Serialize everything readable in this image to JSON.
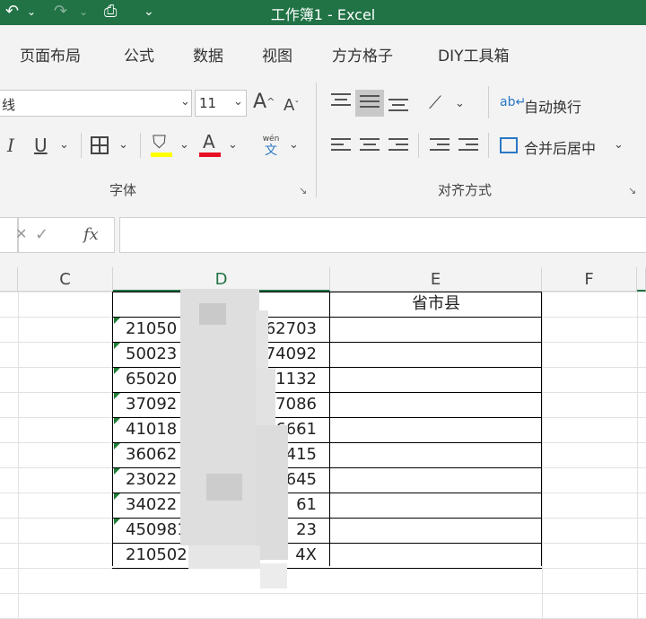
{
  "window": {
    "title": "工作簿1  -  Excel"
  },
  "quick_access": {
    "undo_icon": "undo-icon",
    "redo_icon": "redo-icon",
    "print_preview_icon": "print-preview-icon",
    "customize_icon": "customize-icon"
  },
  "ribbon_tabs": [
    "页面布局",
    "公式",
    "数据",
    "视图",
    "方方格子",
    "DIY工具箱"
  ],
  "font_group": {
    "font_name_partial": "线",
    "font_size": "11",
    "increase_font": "A",
    "decrease_font": "A",
    "italic": "I",
    "underline": "U",
    "font_color_glyph": "A",
    "phonetic_top": "wén",
    "phonetic_bottom": "文",
    "label": "字体",
    "fill_color": "#ffff00",
    "font_color": "#e81123"
  },
  "alignment_group": {
    "wrap_text": "自动换行",
    "merge_center": "合并后居中",
    "label": "对齐方式"
  },
  "formula_bar": {
    "cancel": "✕",
    "enter": "✓",
    "fx": "fx",
    "value": ""
  },
  "columns": [
    "C",
    "D",
    "E",
    "F"
  ],
  "selected_column": "D",
  "header_row": {
    "E": "省市县"
  },
  "id_rows": [
    {
      "left": "21050",
      "right": "262703"
    },
    {
      "left": "50023",
      "right": "074092"
    },
    {
      "left": "65020",
      "right": "11132"
    },
    {
      "left": "37092",
      "right": "57086"
    },
    {
      "left": "41018",
      "right": "6661"
    },
    {
      "left": "36062",
      "right": "415"
    },
    {
      "left": "23022",
      "right": "645"
    },
    {
      "left": "34022",
      "right": "61"
    },
    {
      "left": "450981",
      "right": "23"
    },
    {
      "left": "210502",
      "right": "4X"
    }
  ],
  "colors": {
    "excel_green": "#217346",
    "ribbon_bg": "#f3f3f3",
    "error_triangle": "#1e7e34"
  }
}
